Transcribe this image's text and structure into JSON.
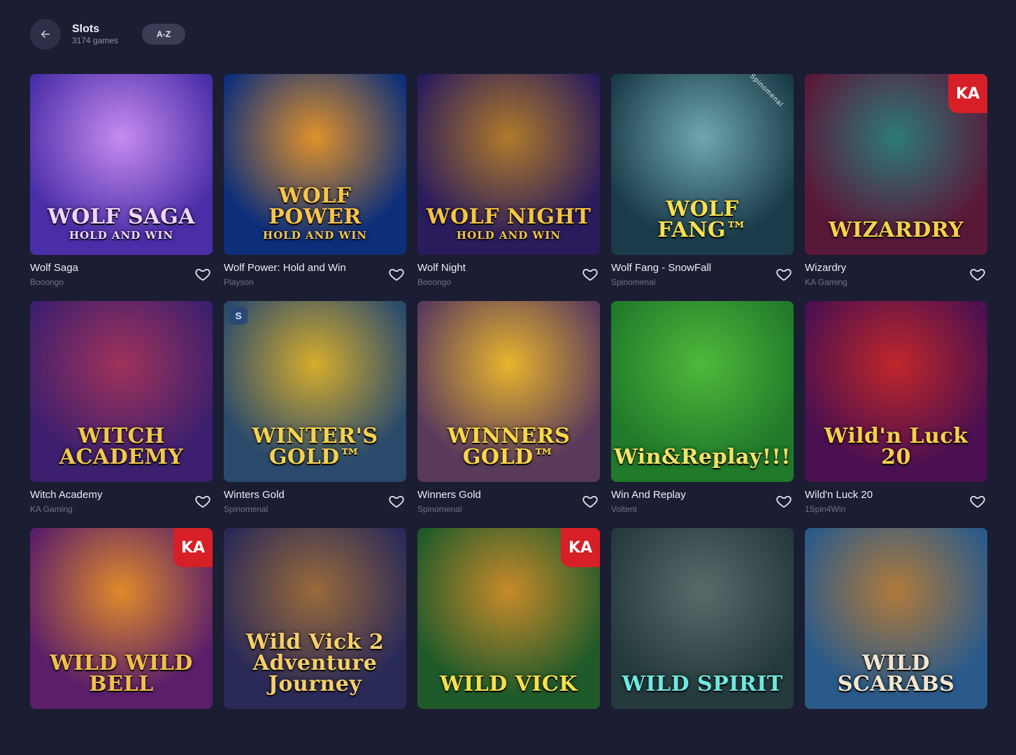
{
  "header": {
    "title": "Slots",
    "count": "3174 games",
    "sort_label": "A-Z"
  },
  "games": [
    {
      "name": "Wolf Saga",
      "provider": "Booongo",
      "art": "WOLF SAGA",
      "art_sub": "HOLD AND WIN",
      "colors": [
        "#4a2ea8",
        "#c78bf0"
      ],
      "text_color": "#f0d6ff",
      "badge": ""
    },
    {
      "name": "Wolf Power: Hold and Win",
      "provider": "Playson",
      "art": "WOLF POWER",
      "art_sub": "HOLD AND WIN",
      "colors": [
        "#0d2f7a",
        "#e0912a"
      ],
      "text_color": "#f6c54a",
      "badge": ""
    },
    {
      "name": "Wolf Night",
      "provider": "Booongo",
      "art": "WOLF NIGHT",
      "art_sub": "HOLD AND WIN",
      "colors": [
        "#2a1c5c",
        "#b07a2a"
      ],
      "text_color": "#f4c542",
      "badge": ""
    },
    {
      "name": "Wolf Fang - SnowFall",
      "provider": "Spinomenal",
      "art": "WOLF FANG™",
      "art_sub": "",
      "colors": [
        "#1a3b4a",
        "#6fa8b0"
      ],
      "text_color": "#f5e050",
      "badge": "spinomenal-tag"
    },
    {
      "name": "Wizardry",
      "provider": "KA Gaming",
      "art": "WIZARDRY",
      "art_sub": "",
      "colors": [
        "#5a1838",
        "#2c7a7a"
      ],
      "text_color": "#f4d24a",
      "badge": "ka"
    },
    {
      "name": "Witch Academy",
      "provider": "KA Gaming",
      "art": "WITCH ACADEMY",
      "art_sub": "",
      "colors": [
        "#3c1f6e",
        "#a0325a"
      ],
      "text_color": "#f0c94a",
      "badge": ""
    },
    {
      "name": "Winters Gold",
      "provider": "Spinomenal",
      "art": "WINTER'S GOLD™",
      "art_sub": "",
      "colors": [
        "#2a4a6c",
        "#d6ad2c"
      ],
      "text_color": "#f5d24e",
      "badge": "s"
    },
    {
      "name": "Winners Gold",
      "provider": "Spinomenal",
      "art": "WINNERS GOLD™",
      "art_sub": "",
      "colors": [
        "#5a3a5c",
        "#e8b52c"
      ],
      "text_color": "#fbd847",
      "badge": ""
    },
    {
      "name": "Win And Replay",
      "provider": "Voltent",
      "art": "Win&Replay!!!",
      "art_sub": "",
      "colors": [
        "#1f7a2a",
        "#4fb83a"
      ],
      "text_color": "#f3e36a",
      "badge": ""
    },
    {
      "name": "Wild'n Luck 20",
      "provider": "1Spin4Win",
      "art": "Wild'n Luck 20",
      "art_sub": "",
      "colors": [
        "#4a1050",
        "#c0262a"
      ],
      "text_color": "#f6cf4a",
      "badge": ""
    },
    {
      "name": "",
      "provider": "",
      "art": "WILD WILD BELL",
      "art_sub": "",
      "colors": [
        "#5a1e6a",
        "#e08a2a"
      ],
      "text_color": "#f2c04a",
      "badge": "ka"
    },
    {
      "name": "",
      "provider": "",
      "art": "Wild Vick 2 Adventure Journey",
      "art_sub": "",
      "colors": [
        "#2a2a58",
        "#9a6a3a"
      ],
      "text_color": "#f5cf6a",
      "badge": ""
    },
    {
      "name": "",
      "provider": "",
      "art": "WILD VICK",
      "art_sub": "",
      "colors": [
        "#1f5a2a",
        "#c88a2a"
      ],
      "text_color": "#f5e04a",
      "badge": "ka"
    },
    {
      "name": "",
      "provider": "",
      "art": "WILD SPIRIT",
      "art_sub": "",
      "colors": [
        "#243a3c",
        "#5a6a6a"
      ],
      "text_color": "#6ee8e0",
      "badge": ""
    },
    {
      "name": "",
      "provider": "",
      "art": "WILD SCARABS",
      "art_sub": "",
      "colors": [
        "#2a5a8a",
        "#b07a3a"
      ],
      "text_color": "#f2e6cf",
      "badge": ""
    }
  ],
  "colors": {
    "background": "#1b1d33",
    "button_bg": "#2d3048",
    "provider_text": "#6f738c"
  },
  "icons": {
    "back": "arrow-left-icon",
    "favorite": "heart-outline-icon"
  }
}
